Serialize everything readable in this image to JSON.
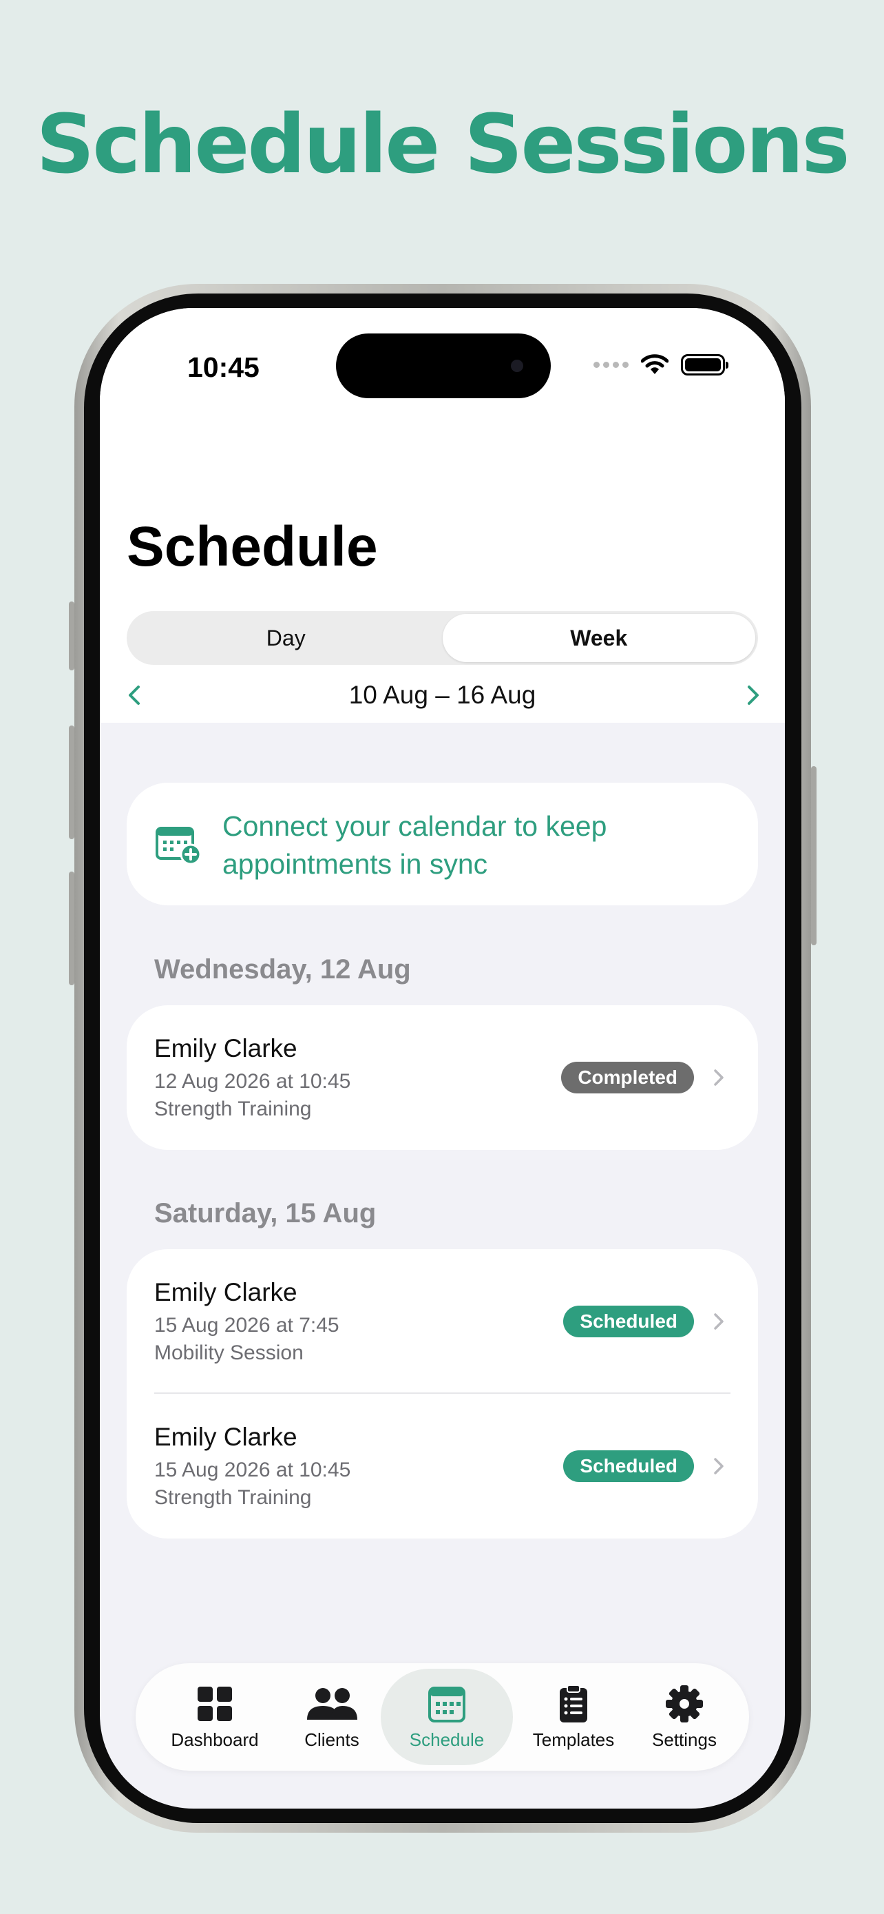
{
  "headline": "Schedule Sessions",
  "status_bar": {
    "time": "10:45"
  },
  "page": {
    "title": "Schedule",
    "segments": [
      "Day",
      "Week"
    ],
    "active_segment": "Week",
    "date_range": "10 Aug – 16 Aug"
  },
  "banner": {
    "text": "Connect your calendar to keep appointments in sync",
    "icon": "calendar-plus-icon"
  },
  "sections": [
    {
      "title": "Wednesday, 12 Aug",
      "sessions": [
        {
          "client": "Emily Clarke",
          "datetime": "12 Aug 2026 at 10:45",
          "type": "Strength Training",
          "status": "Completed"
        }
      ]
    },
    {
      "title": "Saturday, 15 Aug",
      "sessions": [
        {
          "client": "Emily Clarke",
          "datetime": "15 Aug 2026 at 7:45",
          "type": "Mobility Session",
          "status": "Scheduled"
        },
        {
          "client": "Emily Clarke",
          "datetime": "15 Aug 2026 at 10:45",
          "type": "Strength Training",
          "status": "Scheduled"
        }
      ]
    }
  ],
  "tabbar": {
    "items": [
      {
        "label": "Dashboard",
        "icon": "grid-icon"
      },
      {
        "label": "Clients",
        "icon": "people-icon"
      },
      {
        "label": "Schedule",
        "icon": "calendar-icon"
      },
      {
        "label": "Templates",
        "icon": "clipboard-icon"
      },
      {
        "label": "Settings",
        "icon": "gear-icon"
      }
    ],
    "active": "Schedule"
  },
  "colors": {
    "accent": "#2e9e7f",
    "completed": "#6d6d6d",
    "background": "#e3ecea"
  }
}
